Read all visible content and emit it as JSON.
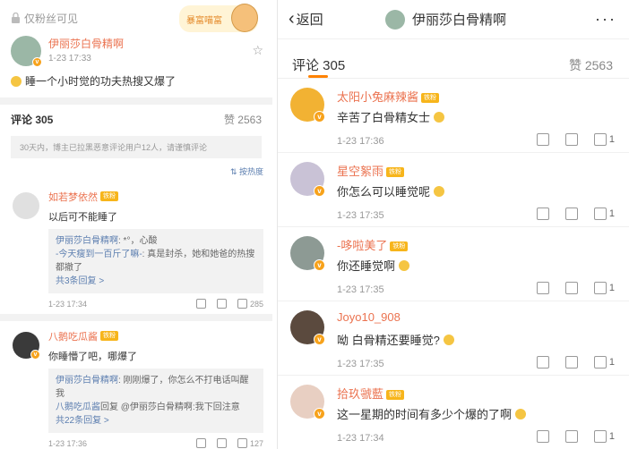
{
  "left": {
    "fans_only": "仅粉丝可见",
    "sticker_text": "暴富喵富",
    "post": {
      "author": "伊丽莎白骨精啊",
      "time": "1-23 17:33",
      "text": "睡一个小时觉的功夫热搜又爆了"
    },
    "comments_label": "评论 305",
    "likes_label": "赞 2563",
    "notice": "30天内，博主已拉黑恶意评论用户12人，请谨慎评论",
    "sort_label": "按热度",
    "comments": [
      {
        "author": "如若梦依然",
        "badge": "铁粉",
        "text": "以后可不能睡了",
        "replies": [
          {
            "name": "伊丽莎白骨精啊",
            "text": ": *°，心酸"
          },
          {
            "name": "-今天瘦到一百斤了嘛-",
            "text": ": 真是封杀，她和她爸的热搜都撤了"
          }
        ],
        "more": "共3条回复 >",
        "time": "1-23 17:34",
        "likes": "285"
      },
      {
        "author": "八鹅吃瓜酱",
        "badge": "铁粉",
        "text": "你睡懵了吧，哪爆了",
        "replies": [
          {
            "name": "伊丽莎白骨精啊",
            "text": ": 刚刚爆了，你怎么不打电话叫醒我"
          },
          {
            "name": "八鹅吃瓜酱",
            "text": "回复 @伊丽莎白骨精啊:我下回注意"
          }
        ],
        "more": "共22条回复 >",
        "time": "1-23 17:36",
        "likes": "127"
      }
    ]
  },
  "right": {
    "back_label": "返回",
    "title": "伊丽莎白骨精啊",
    "comments_label": "评论 305",
    "likes_label": "赞 2563",
    "comments": [
      {
        "author": "太阳小兔麻辣酱",
        "badge": "铁粉",
        "text": "辛苦了白骨精女士",
        "time": "1-23 17:36",
        "likes": "1",
        "avatar_color": "#f2b233"
      },
      {
        "author": "星空絮雨",
        "badge": "铁粉",
        "text": "你怎么可以睡觉呢",
        "time": "1-23 17:35",
        "likes": "1",
        "avatar_color": "#c9c2d6"
      },
      {
        "author": "-哆啦美了",
        "badge": "铁粉",
        "text": "你还睡觉啊",
        "time": "1-23 17:35",
        "likes": "1",
        "avatar_color": "#8d9a94"
      },
      {
        "author": "Joyo10_908",
        "badge": "",
        "text": "呦 白骨精还要睡觉?",
        "time": "1-23 17:35",
        "likes": "1",
        "avatar_color": "#5b4a3e"
      },
      {
        "author": "拾玖虢藍",
        "badge": "铁粉",
        "text": "这一星期的时间有多少个爆的了啊",
        "time": "1-23 17:34",
        "likes": "1",
        "avatar_color": "#e8cfc2"
      }
    ]
  },
  "colors": {
    "name": "#eb7350",
    "link": "#5d7fb0",
    "accent": "#ff8200"
  }
}
